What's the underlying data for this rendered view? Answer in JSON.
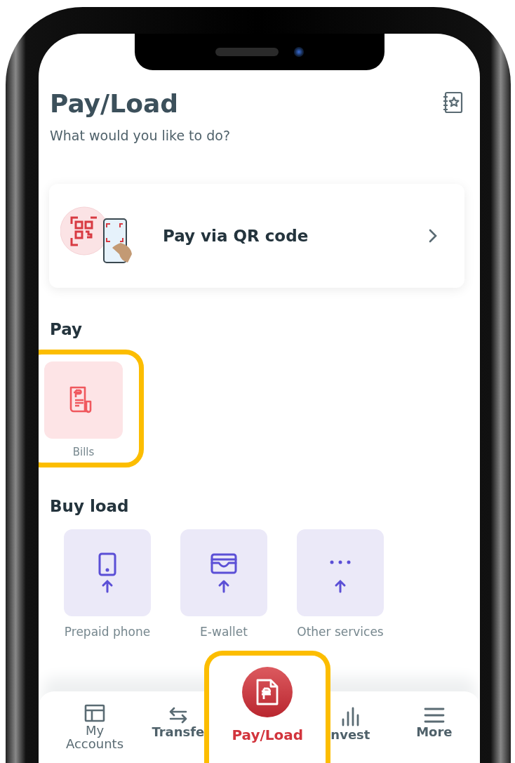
{
  "header": {
    "title": "Pay/Load",
    "subtitle": "What would you like to do?"
  },
  "qr_card": {
    "label": "Pay via QR code"
  },
  "pay": {
    "heading": "Pay",
    "items": [
      {
        "label": "Bills",
        "kind": "bills",
        "highlighted": true
      }
    ]
  },
  "buy_load": {
    "heading": "Buy load",
    "items": [
      {
        "label": "Prepaid phone",
        "kind": "phone",
        "highlighted": false
      },
      {
        "label": "E-wallet",
        "kind": "wallet",
        "highlighted": false
      },
      {
        "label": "Other services",
        "kind": "other",
        "highlighted": false
      }
    ]
  },
  "bottom_nav": [
    {
      "label": "My Accounts",
      "kind": "accounts",
      "selected": false,
      "highlighted": false
    },
    {
      "label": "Transfe",
      "kind": "transfer",
      "selected": false,
      "highlighted": false
    },
    {
      "label": "Pay/Load",
      "kind": "payload",
      "selected": true,
      "highlighted": true
    },
    {
      "label": "nvest",
      "kind": "invest",
      "selected": false,
      "highlighted": false
    },
    {
      "label": "More",
      "kind": "more",
      "selected": false,
      "highlighted": false
    }
  ]
}
